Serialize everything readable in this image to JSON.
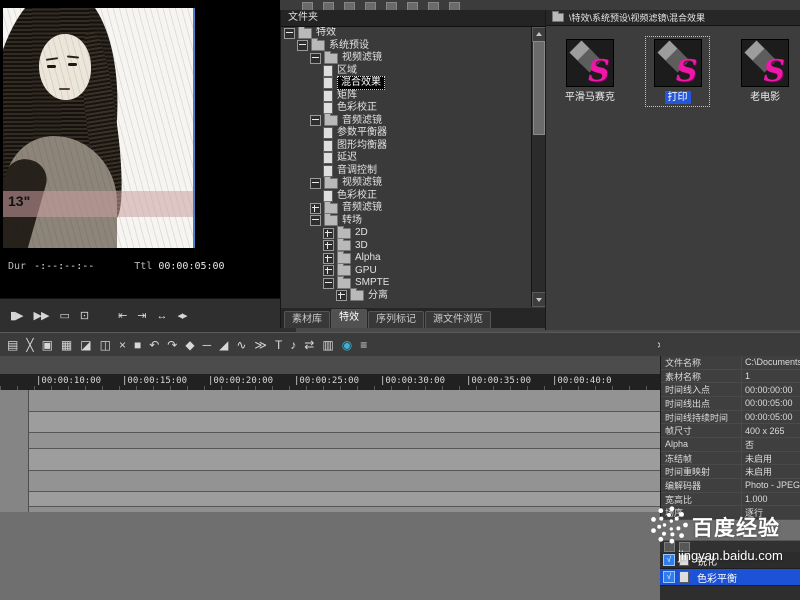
{
  "preview": {
    "overlay_number": "13\"",
    "dur_label": "Dur",
    "dur_value": "-:--:--:--",
    "ttl_label": "Ttl",
    "ttl_value": "00:00:05:00"
  },
  "transport": {
    "buttons": [
      {
        "name": "play",
        "glyph": "▮▶"
      },
      {
        "name": "fast-forward",
        "glyph": "▶▶"
      },
      {
        "name": "display-mode",
        "glyph": "▭"
      },
      {
        "name": "loop",
        "glyph": "⊡"
      },
      {
        "name": "go-to-in",
        "glyph": "⇤"
      },
      {
        "name": "go-to-out",
        "glyph": "⇥"
      },
      {
        "name": "play-in-out",
        "glyph": "↔"
      },
      {
        "name": "jog",
        "glyph": "◂▸"
      }
    ]
  },
  "bin": {
    "header": "文件夹",
    "tabs": [
      {
        "label": "素材库",
        "active": false
      },
      {
        "label": "特效",
        "active": true
      },
      {
        "label": "序列标记",
        "active": false
      },
      {
        "label": "源文件浏览",
        "active": false
      }
    ],
    "tree": [
      {
        "depth": 0,
        "type": "folder",
        "expanded": true,
        "label": "特效",
        "selected": false
      },
      {
        "depth": 1,
        "type": "folder",
        "expanded": true,
        "label": "系统预设",
        "selected": false
      },
      {
        "depth": 2,
        "type": "folder",
        "expanded": true,
        "label": "视频滤镜",
        "selected": false
      },
      {
        "depth": 3,
        "type": "item",
        "expanded": null,
        "label": "区域",
        "selected": false
      },
      {
        "depth": 3,
        "type": "item",
        "expanded": null,
        "label": "混合效果",
        "selected": true
      },
      {
        "depth": 3,
        "type": "item",
        "expanded": null,
        "label": "矩阵",
        "selected": false
      },
      {
        "depth": 3,
        "type": "item",
        "expanded": null,
        "label": "色彩校正",
        "selected": false
      },
      {
        "depth": 2,
        "type": "folder",
        "expanded": true,
        "label": "音频滤镜",
        "selected": false
      },
      {
        "depth": 3,
        "type": "item",
        "expanded": null,
        "label": "参数平衡器",
        "selected": false
      },
      {
        "depth": 3,
        "type": "item",
        "expanded": null,
        "label": "图形均衡器",
        "selected": false
      },
      {
        "depth": 3,
        "type": "item",
        "expanded": null,
        "label": "延迟",
        "selected": false
      },
      {
        "depth": 3,
        "type": "item",
        "expanded": null,
        "label": "音调控制",
        "selected": false
      },
      {
        "depth": 2,
        "type": "folder",
        "expanded": true,
        "label": "视频滤镜",
        "selected": false
      },
      {
        "depth": 3,
        "type": "item",
        "expanded": null,
        "label": "色彩校正",
        "selected": false
      },
      {
        "depth": 2,
        "type": "folder",
        "expanded": false,
        "label": "音频滤镜",
        "selected": false
      },
      {
        "depth": 2,
        "type": "folder",
        "expanded": true,
        "label": "转场",
        "selected": false
      },
      {
        "depth": 3,
        "type": "folder",
        "expanded": false,
        "label": "2D",
        "selected": false
      },
      {
        "depth": 3,
        "type": "folder",
        "expanded": false,
        "label": "3D",
        "selected": false
      },
      {
        "depth": 3,
        "type": "folder",
        "expanded": false,
        "label": "Alpha",
        "selected": false
      },
      {
        "depth": 3,
        "type": "folder",
        "expanded": false,
        "label": "GPU",
        "selected": false
      },
      {
        "depth": 3,
        "type": "folder",
        "expanded": true,
        "label": "SMPTE",
        "selected": false
      },
      {
        "depth": 4,
        "type": "folder",
        "expanded": false,
        "label": "分离",
        "selected": false
      }
    ]
  },
  "palette": {
    "path": "\\特效\\系统预设\\视频滤镜\\混合效果",
    "logo_letter": "S",
    "items": [
      {
        "label": "平滑马赛克",
        "selected": false
      },
      {
        "label": "打印",
        "selected": true
      },
      {
        "label": "老电影",
        "selected": false
      }
    ]
  },
  "toolbar": {
    "close_glyph": "×",
    "icons": [
      {
        "name": "save",
        "glyph": "▤"
      },
      {
        "name": "cut",
        "glyph": "╳"
      },
      {
        "name": "copy",
        "glyph": "▣"
      },
      {
        "name": "paste",
        "glyph": "▦"
      },
      {
        "name": "insert-clip",
        "glyph": "◪"
      },
      {
        "name": "overwrite-clip",
        "glyph": "◫"
      },
      {
        "name": "delete",
        "glyph": "×"
      },
      {
        "name": "ripple-delete",
        "glyph": "■"
      },
      {
        "name": "undo",
        "glyph": "↶"
      },
      {
        "name": "redo",
        "glyph": "↷"
      },
      {
        "name": "set-marker",
        "glyph": "◆"
      },
      {
        "name": "trim",
        "glyph": "─"
      },
      {
        "name": "fade",
        "glyph": "◢"
      },
      {
        "name": "waveform",
        "glyph": "∿"
      },
      {
        "name": "speed",
        "glyph": "≫"
      },
      {
        "name": "title",
        "glyph": "T"
      },
      {
        "name": "audio",
        "glyph": "♪"
      },
      {
        "name": "sync",
        "glyph": "⇄"
      },
      {
        "name": "grid",
        "glyph": "▥"
      },
      {
        "name": "record",
        "glyph": "◉"
      },
      {
        "name": "list",
        "glyph": "≡"
      }
    ]
  },
  "timeline": {
    "ruler_labels": [
      "|00:00:10:00",
      "|00:00:15:00",
      "|00:00:20:00",
      "|00:00:25:00",
      "|00:00:30:00",
      "|00:00:35:00",
      "|00:00:40:0"
    ]
  },
  "properties": {
    "rows": [
      {
        "label": "文件名称",
        "value": "C:\\Documents"
      },
      {
        "label": "素材名称",
        "value": "1"
      },
      {
        "label": "时间线入点",
        "value": "00:00:00:00"
      },
      {
        "label": "时间线出点",
        "value": "00:00:05:00"
      },
      {
        "label": "时间线持续时间",
        "value": "00:00:05:00"
      },
      {
        "label": "帧尺寸",
        "value": "400 x 265"
      },
      {
        "label": "Alpha",
        "value": "否"
      },
      {
        "label": "冻结帧",
        "value": "未启用"
      },
      {
        "label": "时间重映射",
        "value": "未启用"
      },
      {
        "label": "编解码器",
        "value": "Photo - JPEG"
      },
      {
        "label": "宽高比",
        "value": "1.000"
      },
      {
        "label": "场序",
        "value": "逐行"
      }
    ]
  },
  "info_panel": {
    "check_glyph": "√",
    "rows": [
      {
        "label": "锐化",
        "checked": true,
        "selected": false
      },
      {
        "label": "色彩平衡",
        "checked": true,
        "selected": true
      }
    ]
  },
  "watermark": {
    "title": "百度经验",
    "url": "jingyan.baidu.com"
  }
}
